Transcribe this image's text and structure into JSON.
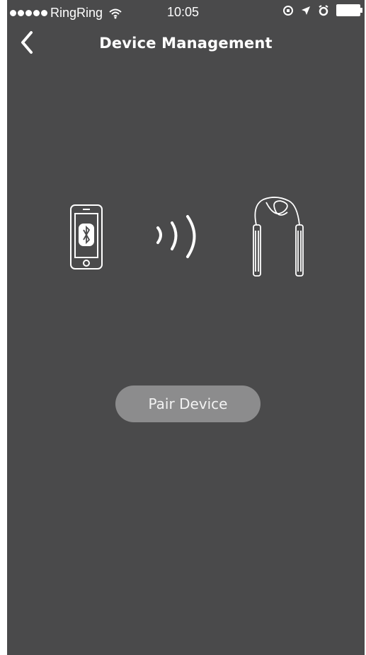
{
  "status_bar": {
    "carrier": "RingRing",
    "time": "10:05"
  },
  "nav": {
    "title": "Device Management",
    "back_icon": "chevron-left-icon"
  },
  "illustration": {
    "phone_icon": "phone-bluetooth-icon",
    "signal_icon": "wireless-signal-icon",
    "device_icon": "jump-rope-icon"
  },
  "main": {
    "pair_button_label": "Pair Device"
  },
  "colors": {
    "background": "#4a4a4b",
    "button": "#8c8c8d",
    "text": "#ffffff"
  }
}
